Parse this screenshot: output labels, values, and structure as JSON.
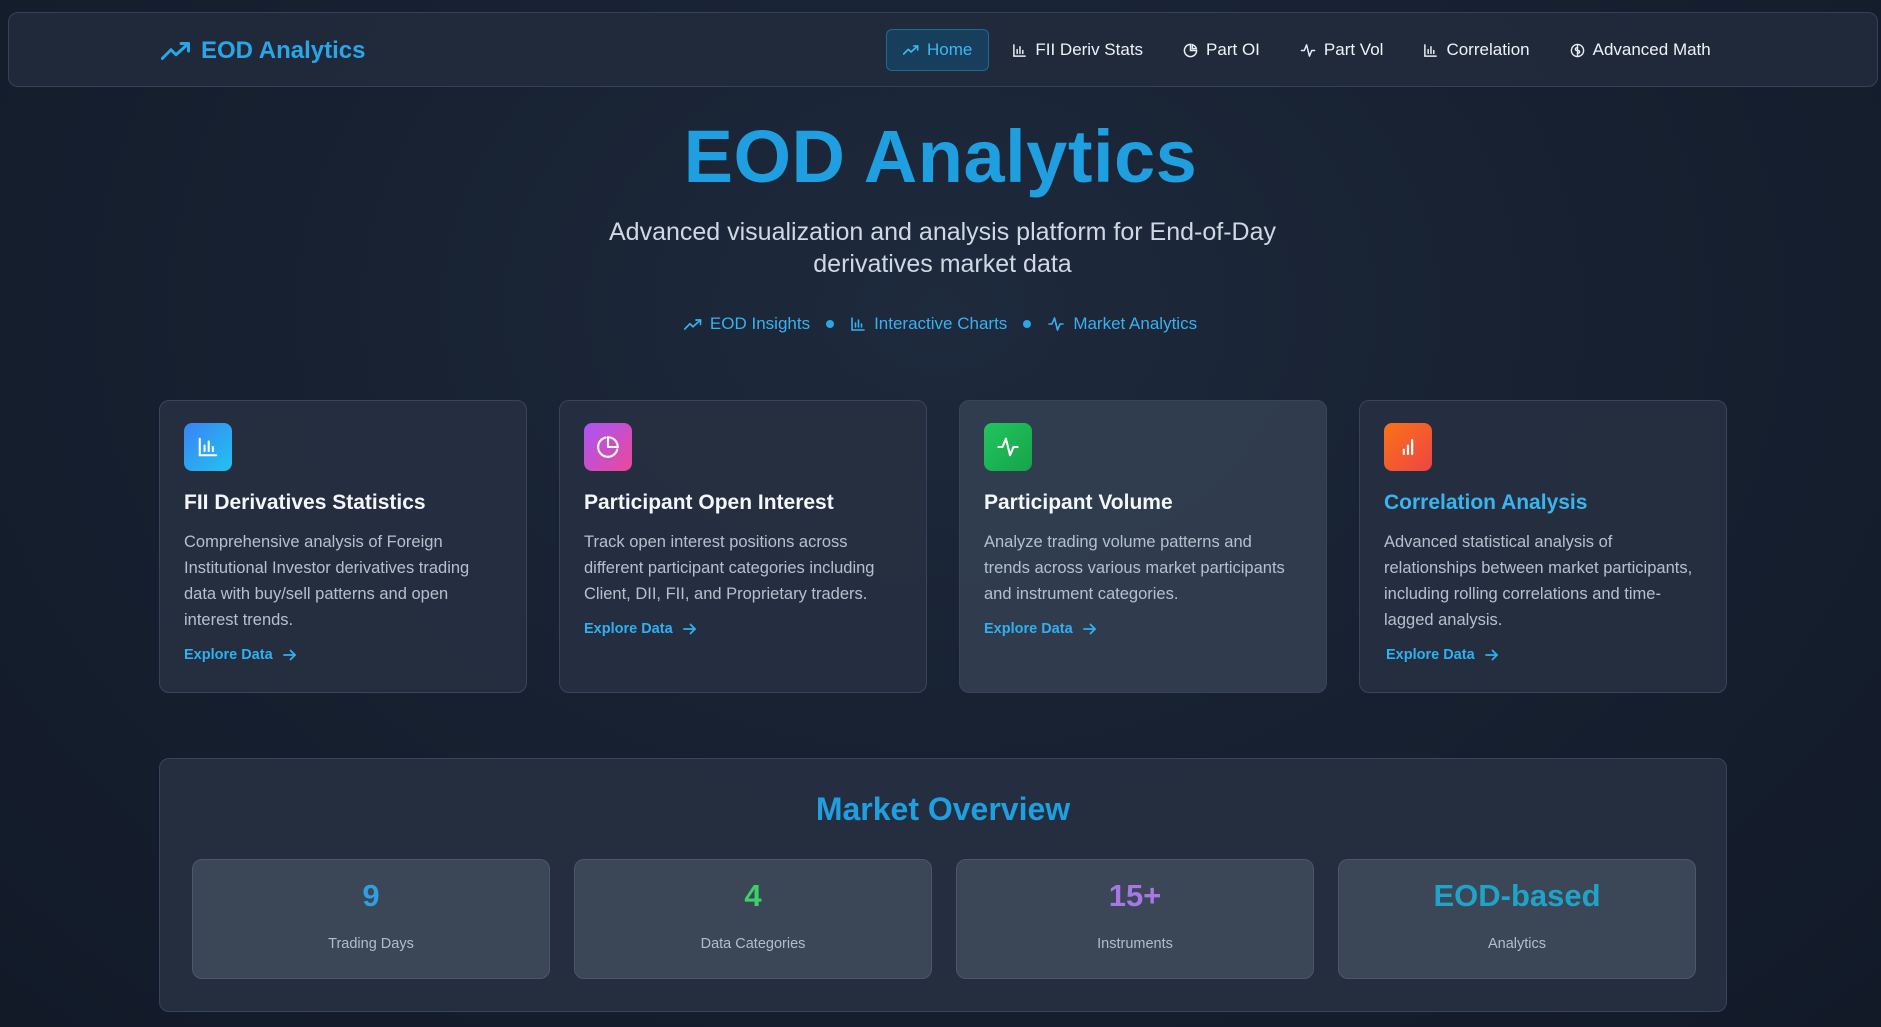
{
  "nav": {
    "brand": "EOD Analytics",
    "items": [
      {
        "label": "Home",
        "icon": "trending-up-icon",
        "active": true
      },
      {
        "label": "FII Deriv Stats",
        "icon": "bar-chart-icon"
      },
      {
        "label": "Part OI",
        "icon": "pie-chart-icon"
      },
      {
        "label": "Part Vol",
        "icon": "activity-icon"
      },
      {
        "label": "Correlation",
        "icon": "bar-chart-icon"
      },
      {
        "label": "Advanced Math",
        "icon": "brain-icon"
      }
    ]
  },
  "hero": {
    "title": "EOD Analytics",
    "subtitle": "Advanced visualization and analysis platform for End-of-Day derivatives market data",
    "tags": [
      {
        "label": "EOD Insights",
        "icon": "trending-up-icon"
      },
      {
        "label": "Interactive Charts",
        "icon": "bar-chart-icon"
      },
      {
        "label": "Market Analytics",
        "icon": "activity-icon"
      }
    ]
  },
  "cards": [
    {
      "title": "FII Derivatives Statistics",
      "description": "Comprehensive analysis of Foreign Institutional Investor derivatives trading data with buy/sell patterns and open interest trends.",
      "link": "Explore Data",
      "icon": "bar-chart-icon",
      "color_from": "#3b82f6",
      "color_to": "#22c3ee"
    },
    {
      "title": "Participant Open Interest",
      "description": "Track open interest positions across different participant categories including Client, DII, FII, and Proprietary traders.",
      "link": "Explore Data",
      "icon": "pie-chart-icon",
      "color_from": "#a855f7",
      "color_to": "#ec4899"
    },
    {
      "title": "Participant Volume",
      "description": "Analyze trading volume patterns and trends across various market participants and instrument categories.",
      "link": "Explore Data",
      "icon": "activity-icon",
      "color_from": "#22c55e",
      "color_to": "#16a34a"
    },
    {
      "title": "Correlation Analysis",
      "description": "Advanced statistical analysis of relationships between market participants, including rolling correlations and time-lagged analysis.",
      "link": "Explore Data",
      "icon": "bar-chart-small-icon",
      "color_from": "#f97316",
      "color_to": "#ef4444"
    }
  ],
  "overview": {
    "title": "Market Overview",
    "stats": [
      {
        "value": "9",
        "label": "Trading Days",
        "color": "#2f9fe0"
      },
      {
        "value": "4",
        "label": "Data Categories",
        "color": "#3ecf6a"
      },
      {
        "value": "15+",
        "label": "Instruments",
        "color": "#a777e6"
      },
      {
        "value": "EOD-based",
        "label": "Analytics",
        "color": "#1fa3c8"
      }
    ]
  },
  "colors": {
    "accent": "#1f9fe0",
    "background": "#172131"
  }
}
